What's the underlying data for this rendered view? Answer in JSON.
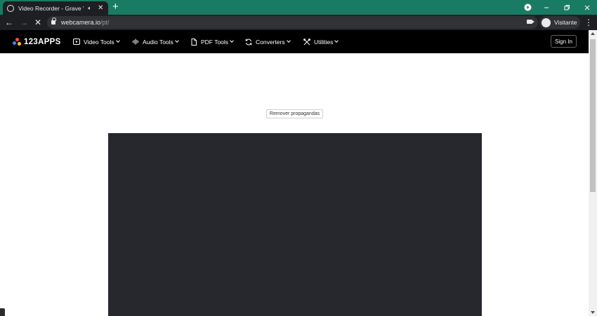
{
  "browser": {
    "tab": {
      "title": "Video Recorder - Grave Vídeo",
      "audio_icon": "speaker-icon",
      "close_icon": "close-icon"
    },
    "new_tab_icon": "plus-icon",
    "window_controls": [
      "media-control-icon",
      "minimize-icon",
      "restore-icon",
      "close-window-icon"
    ],
    "url": {
      "host": "webcamera.io",
      "path": "/pt/"
    },
    "profile_name": "Visitante"
  },
  "site": {
    "logo": "123APPS",
    "nav_items": [
      {
        "label": "Video Tools",
        "icon": "video-icon"
      },
      {
        "label": "Audio Tools",
        "icon": "waveform-icon"
      },
      {
        "label": "PDF Tools",
        "icon": "document-icon"
      },
      {
        "label": "Converters",
        "icon": "convert-icon"
      },
      {
        "label": "Utilities",
        "icon": "tools-icon"
      }
    ],
    "sign_in": "Sign In"
  },
  "main": {
    "remove_ads": "Remover propagandas"
  },
  "colors": {
    "tabstrip": "#197b63",
    "toolbar": "#1d1f22",
    "site_nav": "#000000",
    "video_area": "#27282e",
    "logo_dots": [
      "#4285f4",
      "#ff4b4b",
      "#ffc02e"
    ]
  }
}
